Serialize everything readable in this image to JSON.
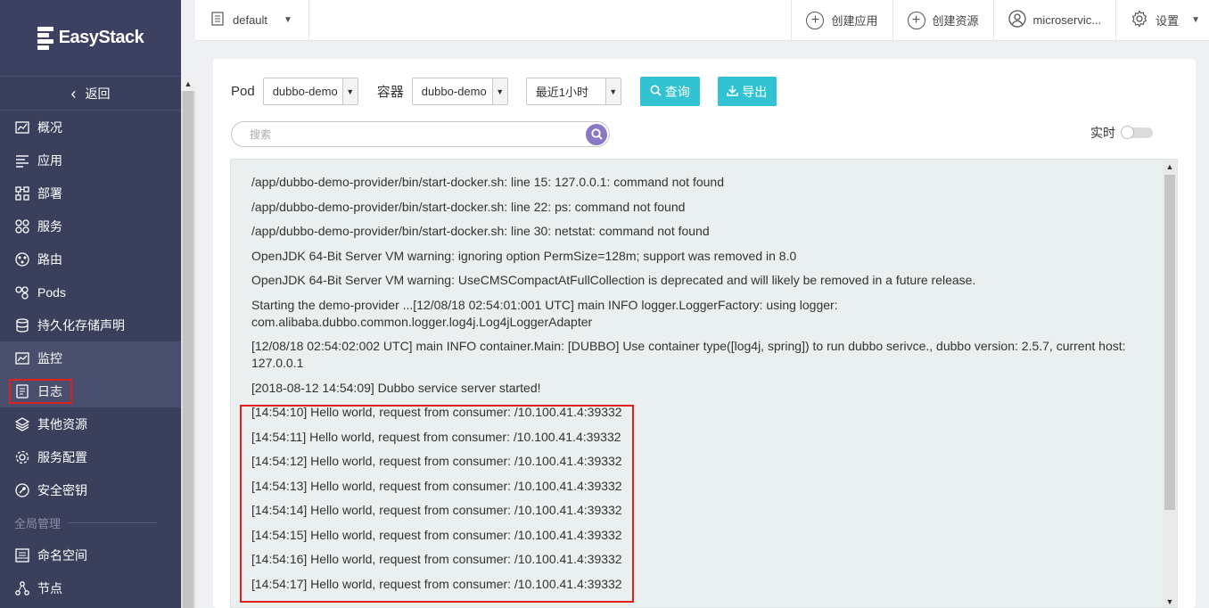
{
  "brand": {
    "name": "EasyStack"
  },
  "sidebar": {
    "back_label": "返回",
    "items": [
      {
        "label": "概况",
        "icon": "chart-icon"
      },
      {
        "label": "应用",
        "icon": "list-icon"
      },
      {
        "label": "部署",
        "icon": "deploy-icon"
      },
      {
        "label": "服务",
        "icon": "service-icon"
      },
      {
        "label": "路由",
        "icon": "route-icon"
      },
      {
        "label": "Pods",
        "icon": "pods-icon"
      },
      {
        "label": "持久化存储声明",
        "icon": "storage-icon"
      },
      {
        "label": "监控",
        "icon": "monitor-icon"
      },
      {
        "label": "日志",
        "icon": "log-icon"
      },
      {
        "label": "其他资源",
        "icon": "layers-icon"
      },
      {
        "label": "服务配置",
        "icon": "config-icon"
      },
      {
        "label": "安全密钥",
        "icon": "key-icon"
      }
    ],
    "section_global": "全局管理",
    "global_items": [
      {
        "label": "命名空间",
        "icon": "namespace-icon"
      },
      {
        "label": "节点",
        "icon": "node-icon"
      }
    ]
  },
  "topbar": {
    "namespace": "default",
    "create_app": "创建应用",
    "create_resource": "创建资源",
    "user": "microservic...",
    "settings": "设置"
  },
  "filters": {
    "pod_label": "Pod",
    "pod_value": "dubbo-demo",
    "container_label": "容器",
    "container_value": "dubbo-demo",
    "time_value": "最近1小时",
    "query_button": "查询",
    "export_button": "导出",
    "search_placeholder": "搜索",
    "realtime_label": "实时"
  },
  "log": {
    "lines": [
      "/app/dubbo-demo-provider/bin/start-docker.sh: line 15: 127.0.0.1: command not found",
      "/app/dubbo-demo-provider/bin/start-docker.sh: line 22: ps: command not found",
      "/app/dubbo-demo-provider/bin/start-docker.sh: line 30: netstat: command not found",
      "OpenJDK 64-Bit Server VM warning: ignoring option PermSize=128m; support was removed in 8.0",
      "OpenJDK 64-Bit Server VM warning: UseCMSCompactAtFullCollection is deprecated and will likely be removed in a future release.",
      "Starting the demo-provider ...[12/08/18 02:54:01:001 UTC] main INFO logger.LoggerFactory: using logger: com.alibaba.dubbo.common.logger.log4j.Log4jLoggerAdapter",
      "[12/08/18 02:54:02:002 UTC] main INFO container.Main: [DUBBO] Use container type([log4j, spring]) to run dubbo serivce., dubbo version: 2.5.7, current host: 127.0.0.1",
      "[2018-08-12 14:54:09] Dubbo service server started!",
      "[14:54:10] Hello world, request from consumer: /10.100.41.4:39332",
      "[14:54:11] Hello world, request from consumer: /10.100.41.4:39332",
      "[14:54:12] Hello world, request from consumer: /10.100.41.4:39332",
      "[14:54:13] Hello world, request from consumer: /10.100.41.4:39332",
      "[14:54:14] Hello world, request from consumer: /10.100.41.4:39332",
      "[14:54:15] Hello world, request from consumer: /10.100.41.4:39332",
      "[14:54:16] Hello world, request from consumer: /10.100.41.4:39332",
      "[14:54:17] Hello world, request from consumer: /10.100.41.4:39332"
    ]
  },
  "colors": {
    "sidebar_bg": "#3a3f5c",
    "accent": "#31c3d2",
    "search_button": "#8a78c7",
    "highlight": "#e02020"
  }
}
